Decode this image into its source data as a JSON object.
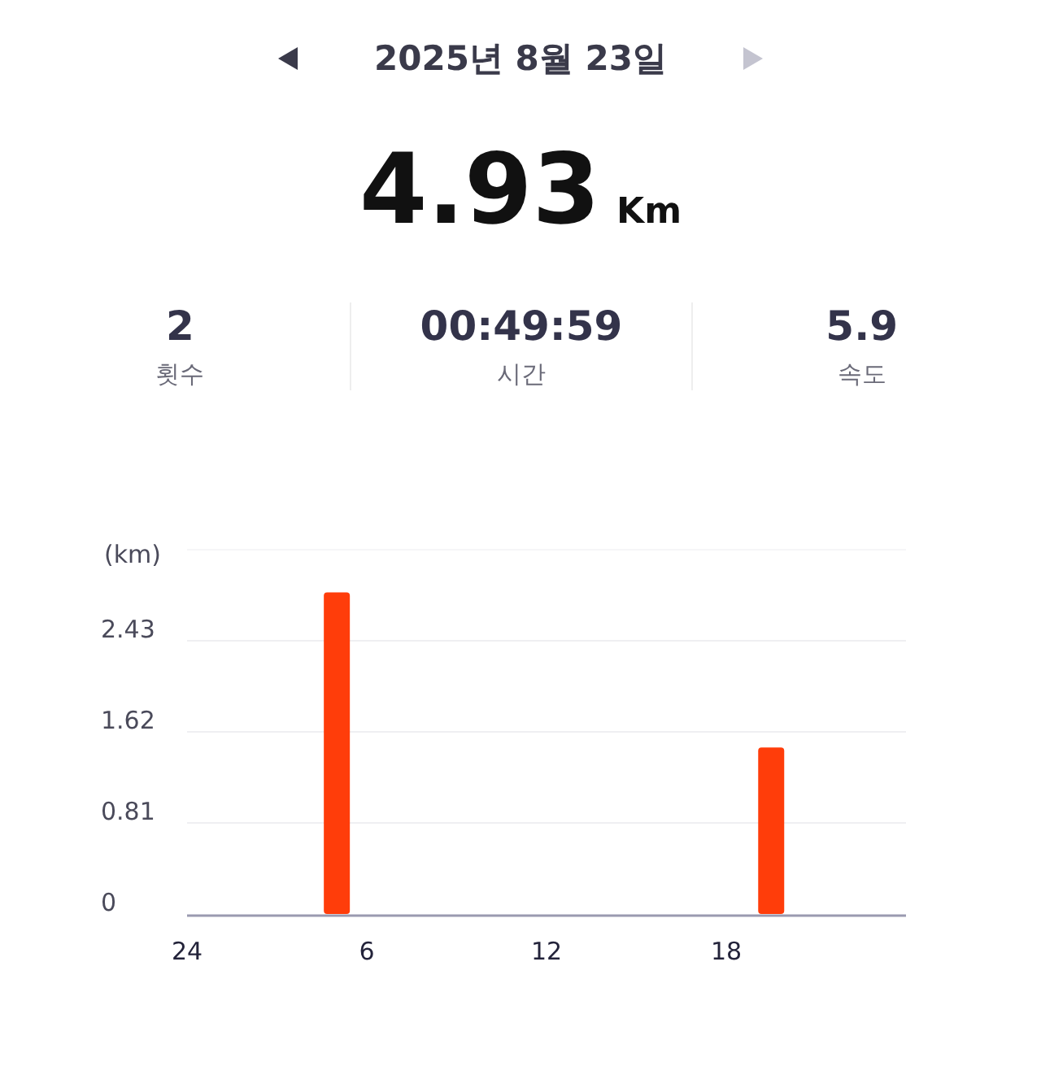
{
  "header": {
    "date": "2025년 8월 23일",
    "prev_disabled": false,
    "next_disabled": true
  },
  "distance": {
    "value": "4.93",
    "unit": "Km"
  },
  "stats": [
    {
      "value": "2",
      "label": "횟수"
    },
    {
      "value": "00:49:59",
      "label": "시간"
    },
    {
      "value": "5.9",
      "label": "속도"
    }
  ],
  "chart": {
    "chart_data": {
      "type": "bar",
      "ylabel": "(km)",
      "x": [
        5,
        19.5
      ],
      "series": [
        {
          "color": "#ff3d0a",
          "values": [
            2.86,
            1.48
          ]
        }
      ],
      "xlim": [
        0,
        24
      ],
      "ylim": [
        0,
        3.24
      ],
      "yticks": [
        0,
        0.81,
        1.62,
        2.43
      ],
      "xticks": [
        6,
        12,
        18
      ],
      "grid": true
    },
    "axis_start_label": "24"
  }
}
